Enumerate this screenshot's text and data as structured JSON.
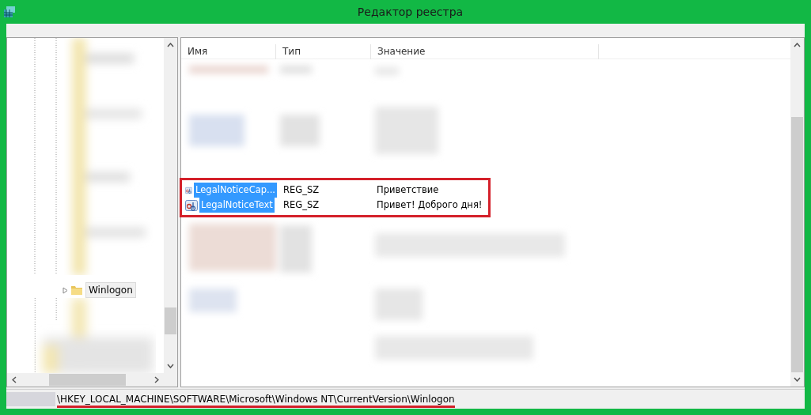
{
  "window": {
    "title": "Редактор реестра"
  },
  "tree": {
    "items": [
      {
        "label": "Winlogon",
        "expanded": false,
        "selected": true
      }
    ]
  },
  "values_table": {
    "columns": [
      "Имя",
      "Тип",
      "Значение"
    ],
    "rows": [
      {
        "name": "LegalNoticeCap...",
        "type": "REG_SZ",
        "data": "Приветствие",
        "selected": true
      },
      {
        "name": "LegalNoticeText",
        "type": "REG_SZ",
        "data": "Привет! Доброго дня!",
        "selected": true
      }
    ]
  },
  "status_bar": {
    "path": "\\HKEY_LOCAL_MACHINE\\SOFTWARE\\Microsoft\\Windows NT\\CurrentVersion\\Winlogon"
  }
}
